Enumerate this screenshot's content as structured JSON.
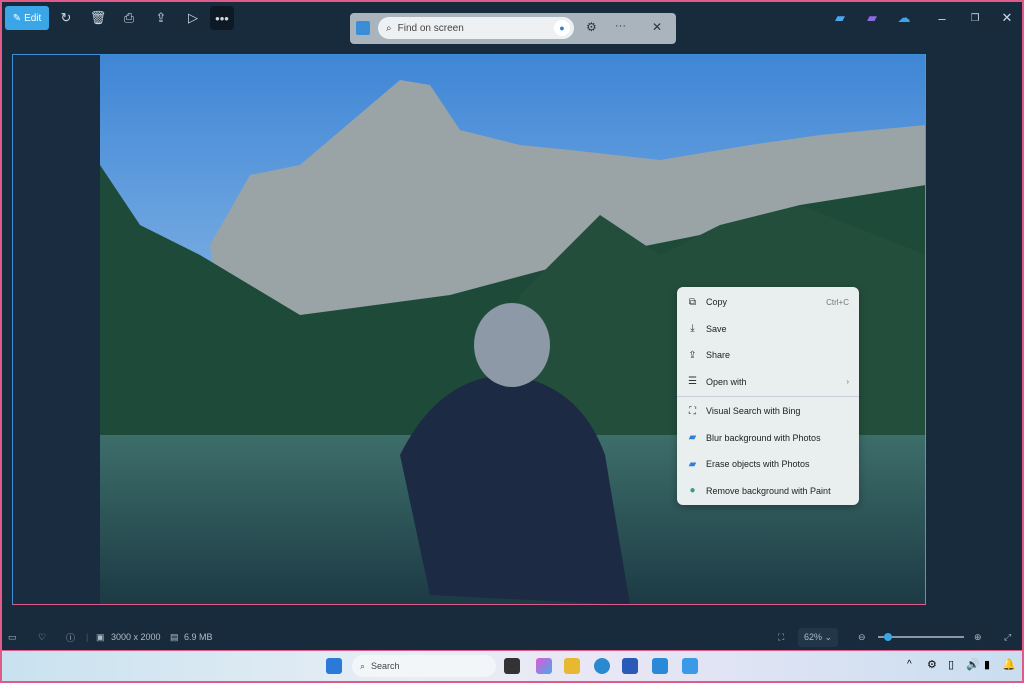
{
  "toolbar": {
    "edit_label": "Edit",
    "icons": [
      "rotate-icon",
      "delete-icon",
      "print-icon",
      "share-icon",
      "slideshow-icon",
      "more-icon"
    ]
  },
  "find": {
    "placeholder": "Find on screen"
  },
  "context_menu": {
    "items": [
      {
        "label": "Copy",
        "shortcut": "Ctrl+C",
        "icon": "copy-icon"
      },
      {
        "label": "Save",
        "icon": "download-icon"
      },
      {
        "label": "Share",
        "icon": "share-icon"
      },
      {
        "label": "Open with",
        "icon": "open-with-icon",
        "submenu": true
      },
      {
        "label": "Visual Search with Bing",
        "icon": "visual-search-icon"
      },
      {
        "label": "Blur background with Photos",
        "icon": "photos-icon"
      },
      {
        "label": "Erase objects with Photos",
        "icon": "photos-icon"
      },
      {
        "label": "Remove background with Paint",
        "icon": "paint-icon"
      }
    ]
  },
  "status": {
    "dimensions": "3000 x 2000",
    "size": "6.9 MB",
    "zoom": "62%",
    "zoom_slider": 0.08
  },
  "taskbar": {
    "search_placeholder": "Search"
  },
  "colors": {
    "accent": "#3aa6e8",
    "window": "#172b3d"
  }
}
